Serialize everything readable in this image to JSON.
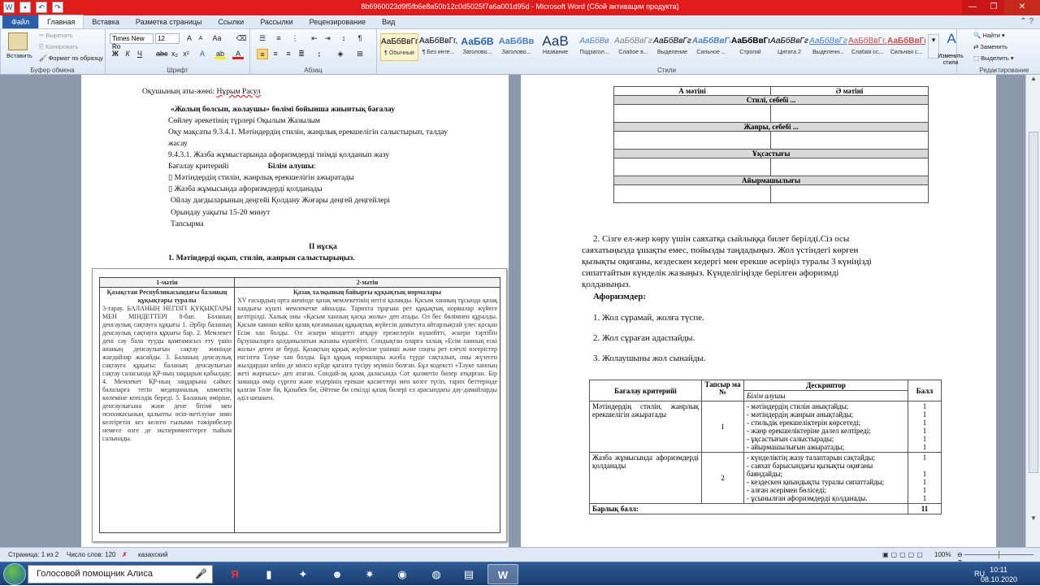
{
  "window": {
    "title": "8b6960023d9f5fb6e8a50b12c0d5025f7a6a001d95d - Microsoft Word (Сбой активации продукта)"
  },
  "ribbon_tabs": [
    "Файл",
    "Главная",
    "Вставка",
    "Разметка страницы",
    "Ссылки",
    "Рассылки",
    "Рецензирование",
    "Вид"
  ],
  "clipboard": {
    "paste": "Вставить",
    "cut": "Вырезать",
    "copy": "Копировать",
    "format": "Формат по образцу",
    "label": "Буфер обмена"
  },
  "font": {
    "name": "Times New Ro",
    "size": "12",
    "label": "Шрифт"
  },
  "paragraph": {
    "label": "Абзац"
  },
  "styles": {
    "label": "Стили",
    "items": [
      {
        "preview": "АаБбВвГг,",
        "name": "¶ Обычный"
      },
      {
        "preview": "АаБбВвГг,",
        "name": "¶ Без инте..."
      },
      {
        "preview": "АаБбВ",
        "name": "Заголово..."
      },
      {
        "preview": "АаБбВв",
        "name": "Заголово..."
      },
      {
        "preview": "АаВ",
        "name": "Название"
      },
      {
        "preview": "АаБбВв",
        "name": "Подзагол..."
      },
      {
        "preview": "АаБбВвГг",
        "name": "Слабое в..."
      },
      {
        "preview": "АаБбВвГг",
        "name": "Выделение"
      },
      {
        "preview": "АаБбВвГг",
        "name": "Сильное ..."
      },
      {
        "preview": "АаБбВвГг,",
        "name": "Строгий"
      },
      {
        "preview": "АаБбВвГг",
        "name": "Цитата 2"
      },
      {
        "preview": "АаБбВвГг",
        "name": "Выделенн..."
      },
      {
        "preview": "АаБбВвГг,",
        "name": "Слабая сс..."
      },
      {
        "preview": "АаБбВвГг,",
        "name": "Сильная с..."
      }
    ],
    "change": "Изменить стили"
  },
  "editing": {
    "find": "Найти",
    "replace": "Заменить",
    "select": "Выделить",
    "label": "Редактирование"
  },
  "page1": {
    "student_label": "Оқушының аты-жөні:",
    "student_name": "Нұрым Расул",
    "heading": "«Жолың болсын, жолаушы» бөлімі бойынша жиынтық бағалау",
    "l1": "Сөйлеу әрекетінің түрлері Оқылым          Жазылым",
    "l2": "Оқу мақсаты 9.3.4.1. Мәтіндердің стилін, жанрлық ерекшелігін салыстырып, талдау",
    "l3": "жасау",
    "l4": "9.4.3.1. Жазба жұмыстарында афоризмдерді тиімді қолданып жазу",
    "l5a": "Бағалау критерийі",
    "l5b": "Білім алушы",
    "l6": " Мәтіндердің стилін, жанрлық ерекшелігін ажыратады",
    "l7": " Жазба жұмысында афоризмдерді қолданады",
    "l8": "Ойлау дағдыларының деңгейі Қолдану            Жоғары деңгей деңгейлері",
    "l9": "Орындау уақыты      15-20 минут",
    "l10": "Тапсырма",
    "variant": "ІІ нұсқа",
    "task1": "1.  Мәтіндерді оқып, стилін, жанрын салыстырыңыз."
  },
  "scan": {
    "h1": "1-мәтін",
    "h2": "2-мәтін",
    "c1_title": "Қазақстан Республикасындағы баланың құқықтары туралы",
    "c1_text": "3-тарау. БАЛАНЫҢ НЕГІЗГІ ҚҰҚЫҚТАРЫ МЕН МІНДЕТТЕРІ 8-бап. Баланың денсаулық сақтауға құқығы 1. Әрбір баланың денсаулық сақтауға құқығы бар. 2. Мемлекет дені сау бала тууды қамтамасыз ету үшін ананың денсаулығын сақтау жөнінде жағдайлар жасайды. 3. Баланың денсаулық сақтауға құқығы: баланың денсаулығын сақтау саласында ҚР-ның заңдарын қабылдау; 4. Мемлекет ҚР-ның заңдарына сәйкес балаларға тегін медициналық көмектің көлеміне кепілдік береді. 5. Баланың өміріне, денсаулығына және дене бітімі мен психикасының қалыпты өсіп-жетілуіне зиян келтіретін кез келген ғылыми тәжірибелер немесе өзге де эксперименттерге тыйым салынады.",
    "c2_title": "Қазақ халқының байырғы құқықтық нормалары",
    "c2_text": "XV ғасырдың орта шенінде қазақ мемлекетінің негізі қаланды. Қасым ханның тұсында қазақ хандығы күшті мемлекетке айналды. Тарихта тұңғыш рет құқықтық нормалар жүйеге келтірілді. Халық оны «Қасым ханның қасқа жолы» деп атады. Ол бес бөлімнен құралды. Қасым ханнан кейін қазақ қоғамының құқықтық жүйесін дамытуға айтарлықтай үлес қосқан Есім хан болды. Ол әскери міндетті атқару ережелерін күшейтті, әскери тәртібін бұзушыларға қолданылатын жазаны күшейтті. Сондықтан оларға халық «Есім ханның ескі жолы» деген ат берді. Қазақтың құқық жүйесіне үшінші және соңғы рет елеулі өзгерістер енгізген Тәуке хан болды. Бұл құқық нормалары жазба түрде сақталып, оны жүзеген жылдардан кейін де мінсіз күйде қағазға түсіру мүмкін болған. Бұл кодексті «Тәуке ханның жеті жарғысы» деп атаған. Сондай-ақ қазақ даласында Сот қызметін билер атқарған. Бір заманда өмір сүрген және өздерінің ерекше қасиеттері мен көзге түсіп, тарих беттерінде қалған Төле би, Қазыбек би, Әйтеке би секілді қазақ билері ел арасындағы дау-дамайларды әділ шешкен."
  },
  "table1": {
    "c1": "А мәтіні",
    "c2": "Ә мәтіні",
    "r1": "Стилі, себебі ...",
    "r2": "Жанры, себебі ...",
    "r3": "Ұқсастығы",
    "r4": "Айырмашылығы"
  },
  "task2": {
    "p1": "2.   Сізге ел-жер көру үшін  саяхатқа сыйлыққа билет берілді.Сіз осы",
    "p2": "саяхатыңызда ұшақты емес, пойызды таңдадыңыз. Жол үстіндегі көрген",
    "p3": "қызықты оқиғаны, кездескен кедергі мен ерекше әсеріңіз туралы 3 күніңізді",
    "p4": "сипаттайтын күнделік жазыңыз. Күнделігіңізде берілген  афоризмді",
    "p5": "қолданыңыз.",
    "aph_title": "Афоризмдер:",
    "a1": "1. Жол сұрамай, жолға түспе.",
    "a2": "2. Жол сұраған адаспайды.",
    "a3": "3. Жолаушыны жол сынайды."
  },
  "table2": {
    "h_crit": "Бағалау критерийі",
    "h_task": "Тапсыр ма №",
    "h_desc": "Дескриптор",
    "h_learner": "Білім алушы",
    "h_ball": "Балл",
    "r1_crit": "Мәтіндердің стилін, жанрлық ерекшелігін ажыратады",
    "r1_task": "1",
    "r1_desc": [
      "- мәтіндердің стилін анықтайды;",
      "- мәтіндердің жанрын анықтайды;",
      "- стильдік ерекшеліктерін көрсетеді;",
      "- жанр ерекшеліктеріне дәлел келтіреді;",
      "- ұқсастығын салыстырады;",
      "- айырмашылығын ажыратады;"
    ],
    "r1_ball": [
      "1",
      "1",
      "1",
      "1",
      "1",
      "1"
    ],
    "r2_crit": "Жазба жұмысында афоризмдерді қолданады",
    "r2_task": "2",
    "r2_desc": [
      "- күнделіктің жазу талаптарын сақтайды;",
      "-  саяхат барысындағы қызықты оқиғаны баяндайды;",
      "- кездескен қиындықты туралы сипаттайды;",
      "- алған әсерімен бөліседі;",
      "- ұсынылған афоризмдерді қолданады."
    ],
    "r2_ball": [
      "1",
      "",
      "1",
      "1",
      "1",
      "1"
    ],
    "total_label": "Барлық балл:",
    "total": "11"
  },
  "status": {
    "page": "Страница: 1 из 2",
    "words": "Число слов: 120",
    "lang": "казахский",
    "zoom": "100%"
  },
  "taskbar": {
    "search": "Голосовой помощник Алиса",
    "lang": "RU",
    "time": "10:11",
    "date": "08.10.2020"
  }
}
